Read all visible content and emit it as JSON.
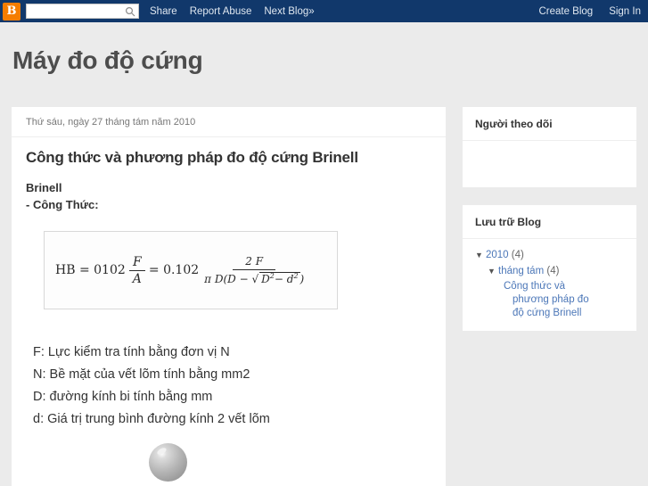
{
  "navbar": {
    "logo_letter": "B",
    "logo_name": "blogger-logo",
    "search": {
      "value": "",
      "placeholder": ""
    },
    "links": [
      {
        "label": "Share",
        "name": "nav-link-share"
      },
      {
        "label": "Report Abuse",
        "name": "nav-link-report-abuse"
      },
      {
        "label": "Next Blog»",
        "name": "nav-link-next-blog"
      }
    ],
    "right_links": [
      {
        "label": "Create Blog",
        "name": "nav-link-create-blog"
      },
      {
        "label": "Sign In",
        "name": "nav-link-sign-in"
      }
    ],
    "background": "#11386b",
    "logo_color": "#f57d00"
  },
  "header": {
    "blog_title": "Máy đo độ cứng"
  },
  "post": {
    "date": "Thứ sáu, ngày 27 tháng tám năm 2010",
    "title": "Công thức và phương pháp đo độ cứng Brinell",
    "subheading": "Brinell",
    "formula_label": "- Công Thức:",
    "formula": {
      "alt": "HB = 0102 F/A = 0.102 · 2F / (πD(D − √(D² − d²)))",
      "lhs": "HB = 0102",
      "num1": "F",
      "den1": "A",
      "eq2": "= 0.102",
      "num2": "2 F",
      "den_pi_d": "π D",
      "den_inner_left": "D −",
      "den_sqrt": "D",
      "den_sqrt_sup": "2",
      "den_minus": "− d",
      "den_sqrt_sup2": "2"
    },
    "definitions": [
      "F: Lực kiểm tra tính bằng đơn vị N",
      "N: Bề mặt của vết lõm tính bằng mm2",
      "D: đường kính bi tính bằng mm",
      "d: Giá trị trung bình đường kính 2 vết lõm"
    ],
    "image_alt": "steel-ball-indenter"
  },
  "sidebar": {
    "followers": {
      "title": "Người theo dõi"
    },
    "archive": {
      "title": "Lưu trữ Blog",
      "year": {
        "arrow": "▼",
        "label": "2010",
        "count": "(4)"
      },
      "month": {
        "arrow": "▼",
        "label": "tháng tám",
        "count": "(4)"
      },
      "post_link": "Công thức và phương pháp đo độ cứng Brinell"
    }
  },
  "colors": {
    "page_bg": "#ebebeb",
    "link_blue": "#4c77b8",
    "navbar_bg": "#11386b",
    "accent_orange": "#f57d00"
  }
}
